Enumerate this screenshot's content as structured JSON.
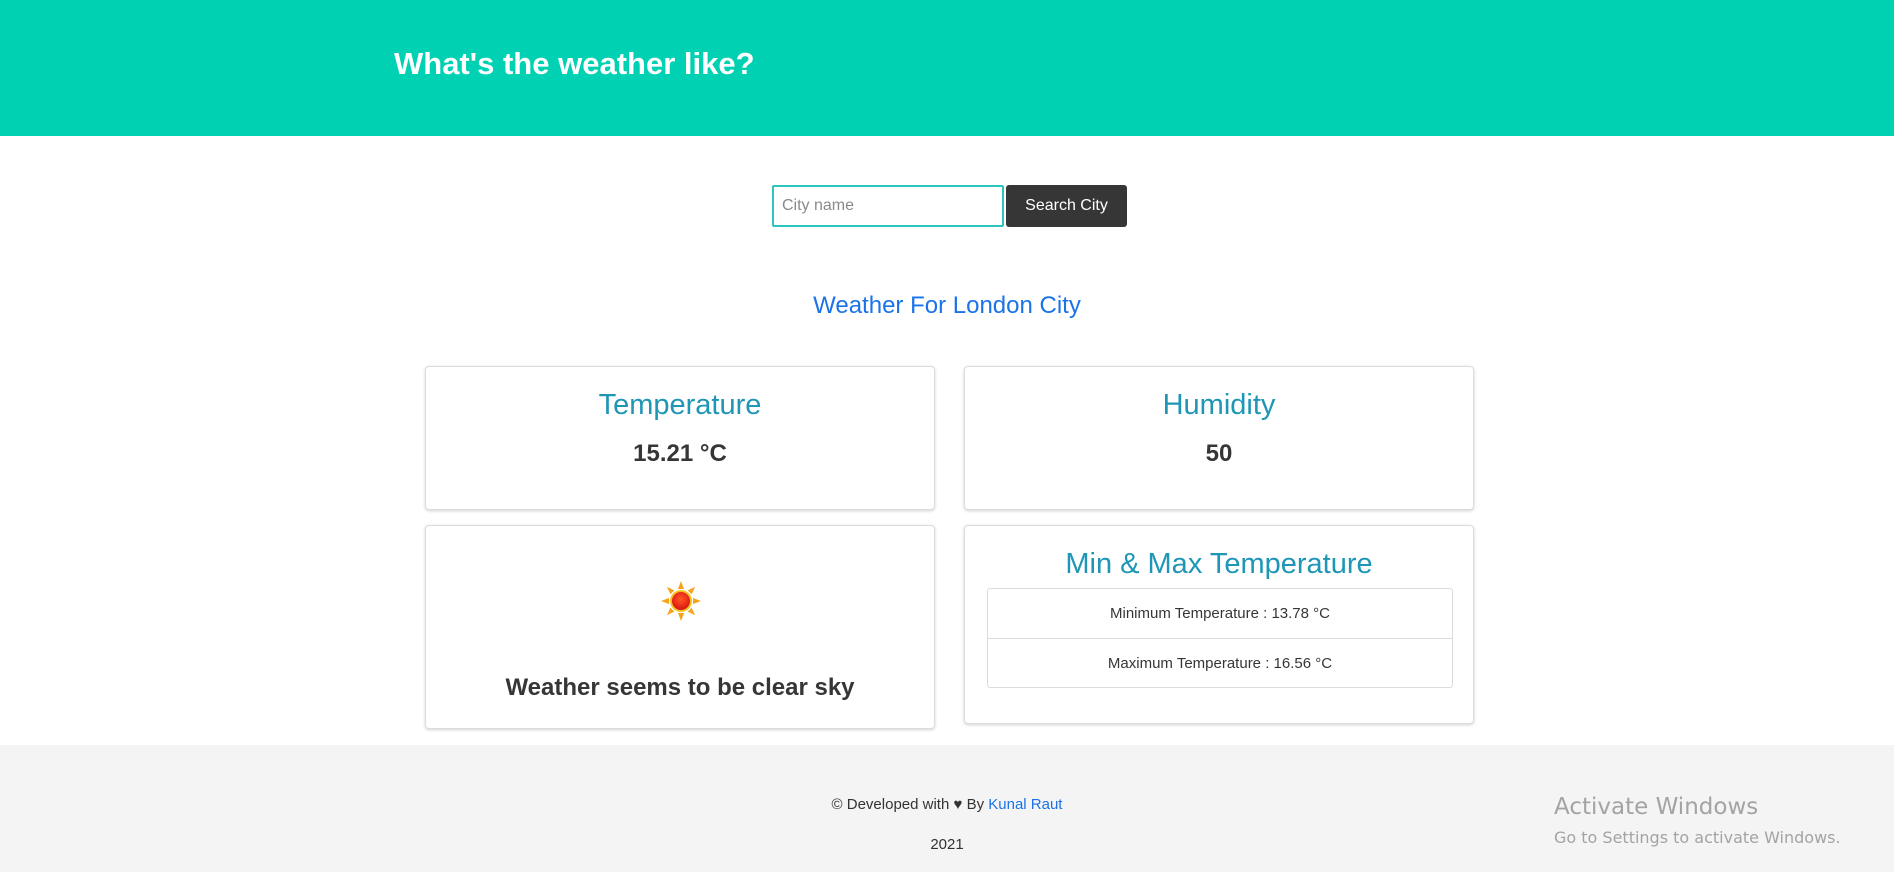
{
  "header": {
    "title": "What's the weather like?"
  },
  "search": {
    "placeholder": "City name",
    "value": "",
    "button_label": "Search City"
  },
  "city_heading": "Weather For London City",
  "cards": {
    "temperature": {
      "title": "Temperature",
      "value": "15.21 °C"
    },
    "humidity": {
      "title": "Humidity",
      "value": "50"
    },
    "weather": {
      "icon": "sun-icon",
      "description": "Weather seems to be clear sky"
    },
    "minmax": {
      "title": "Min & Max Temperature",
      "min": "Minimum Temperature : 13.78 °C",
      "max": "Maximum Temperature : 16.56 °C"
    }
  },
  "footer": {
    "prefix": "© Developed with",
    "heart": "♥",
    "by": "By",
    "author": "Kunal Raut",
    "year": "2021"
  },
  "watermark": {
    "title": "Activate Windows",
    "subtitle": "Go to Settings to activate Windows."
  },
  "colors": {
    "header_bg": "#00d1b2",
    "accent_title": "#1e96b5",
    "link": "#1a73e8",
    "button_bg": "#363636"
  }
}
